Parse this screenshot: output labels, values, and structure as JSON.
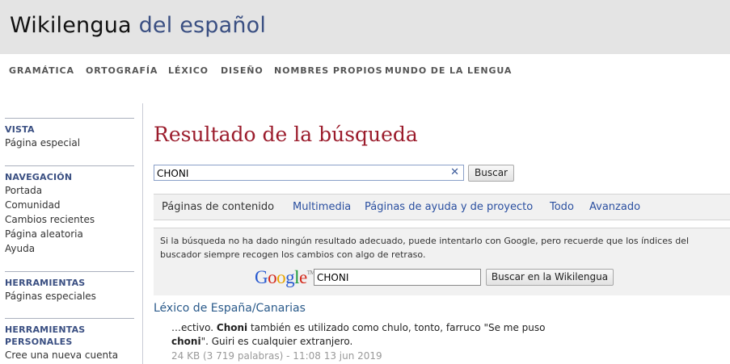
{
  "site": {
    "title_part1": "Wikilengua",
    "title_part2": "del español"
  },
  "topnav": [
    "GRAMÁTICA",
    "ORTOGRAFÍA",
    "LÉXICO",
    "DISEÑO",
    "NOMBRES PROPIOS",
    "MUNDO DE LA LENGUA"
  ],
  "sidebar": {
    "vista": {
      "heading": "VISTA",
      "items": [
        "Página especial"
      ]
    },
    "navegacion": {
      "heading": "NAVEGACIÓN",
      "items": [
        "Portada",
        "Comunidad",
        "Cambios recientes",
        "Página aleatoria",
        "Ayuda"
      ]
    },
    "herramientas": {
      "heading": "HERRAMIENTAS",
      "items": [
        "Páginas especiales"
      ]
    },
    "personales": {
      "heading_line1": "HERRAMIENTAS",
      "heading_line2": "PERSONALES",
      "items": [
        "Cree una nueva cuenta"
      ]
    }
  },
  "main": {
    "title": "Resultado de la búsqueda",
    "search": {
      "value": "CHONI",
      "button": "Buscar"
    },
    "tabs": [
      "Páginas de contenido",
      "Multimedia",
      "Páginas de ayuda y de proyecto",
      "Todo",
      "Avanzado"
    ],
    "notice": {
      "text": "Si la búsqueda no ha dado ningún resultado adecuado, puede intentarlo con Google, pero recuerde que los índices del buscador siempre recogen los cambios con algo de retraso.",
      "google_tm": "TM",
      "google_value": "CHONI",
      "google_button": "Buscar en la Wikilengua"
    },
    "result": {
      "title": "Léxico de España/Canarias",
      "snippet_1": "…ectivo. ",
      "snippet_bold1": "Choni",
      "snippet_2": " también es utilizado como chulo, tonto, farruco \"Se me puso",
      "snippet_bold2": "choni",
      "snippet_3": "\". Guiri es cualquier extranjero.",
      "meta": "24 KB (3 719 palabras) - 11:08 13 jun 2019"
    }
  },
  "colors": {
    "header_bg": "#e4e4e4",
    "title_red": "#9b1c2c",
    "link_blue": "#2a4fa0",
    "brand_blue": "#3a4f82"
  }
}
